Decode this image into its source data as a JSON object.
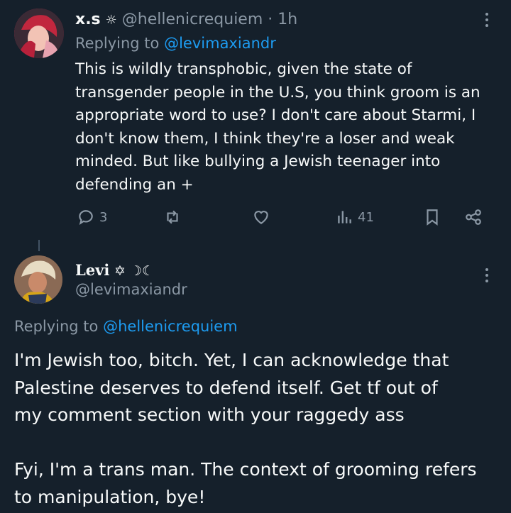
{
  "tweet1": {
    "display_name": "x.s",
    "name_symbol": "☼",
    "handle": "@hellenicrequiem",
    "sep": "·",
    "time": "1h",
    "replying_prefix": "Replying to",
    "replying_to": "@levimaxiandr",
    "body_lines": [
      "This is wildly transphobic, given the state of",
      "transgender people in the U.S, you think groom is an",
      "appropriate word to use? I don't care about Starmi, I",
      "don't know them, I think they're a loser and weak",
      "minded. But like bullying a Jewish teenager into",
      "defending an +"
    ],
    "actions": {
      "reply_count": "3",
      "retweet_count": "",
      "like_count": "",
      "views_count": "41"
    }
  },
  "tweet2": {
    "display_name": "Levi",
    "name_symbols": "✡ ☽☾",
    "handle": "@levimaxiandr",
    "replying_prefix": "Replying to",
    "replying_to": "@hellenicrequiem",
    "body_lines": [
      "I'm Jewish too, bitch. Yet, I can acknowledge that",
      "Palestine deserves to defend itself. Get tf out of",
      "my comment section with your raggedy ass",
      "",
      "Fyi, I'm a trans man. The context of grooming refers",
      "to manipulation, bye!"
    ]
  },
  "colors": {
    "background": "#15202b",
    "text": "#f7f9f9",
    "muted": "#8b98a5",
    "link": "#1d9bf0",
    "thread_line": "#425364"
  },
  "icons": [
    "reply-icon",
    "retweet-icon",
    "like-icon",
    "views-icon",
    "bookmark-icon",
    "share-icon",
    "more-icon"
  ]
}
